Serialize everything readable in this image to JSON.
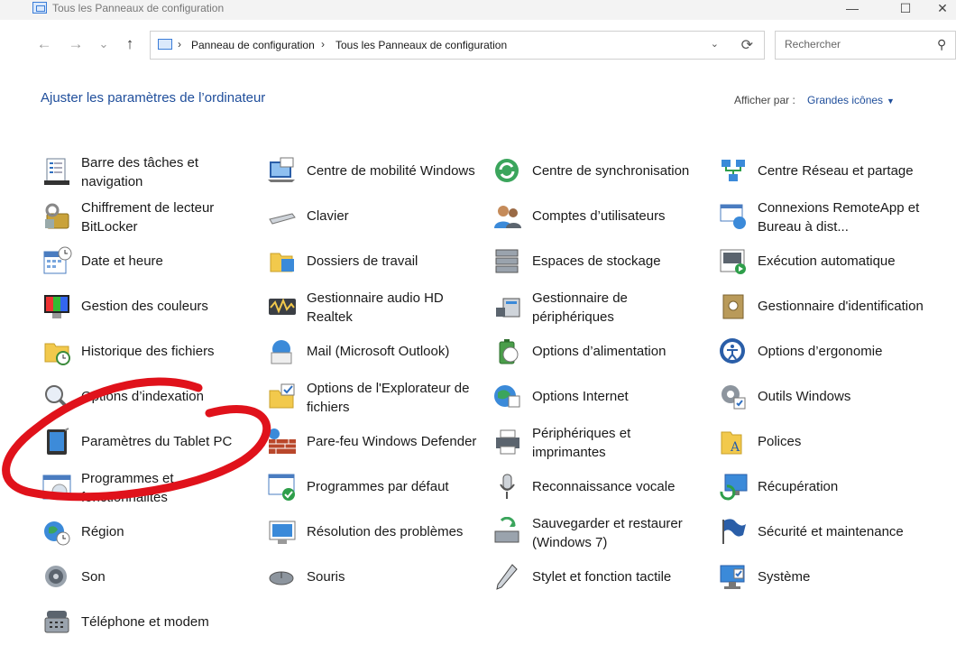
{
  "window": {
    "title": "Tous les Panneaux de configuration",
    "minimize": "—",
    "maximize": "☐",
    "close": "✕"
  },
  "nav": {
    "back": "←",
    "forward": "→",
    "recent": "⌄",
    "up": "↑"
  },
  "address": {
    "crumbs": [
      "Panneau de configuration",
      "Tous les Panneaux de configuration"
    ],
    "separator": "›",
    "dropdown": "⌄",
    "refresh": "⟳"
  },
  "search": {
    "placeholder": "Rechercher"
  },
  "header": {
    "title": "Ajuster les paramètres de l’ordinateur",
    "view_by_label": "Afficher par :",
    "view_by_value": "Grandes icônes",
    "view_arrow": "▼"
  },
  "columns": [
    [
      {
        "label": "Barre des tâches et navigation",
        "icon": "taskbar-icon"
      },
      {
        "label": "Chiffrement de lecteur BitLocker",
        "icon": "bitlocker-icon"
      },
      {
        "label": "Date et heure",
        "icon": "calendar-clock-icon"
      },
      {
        "label": "Gestion des couleurs",
        "icon": "color-management-icon"
      },
      {
        "label": "Historique des fichiers",
        "icon": "file-history-icon"
      },
      {
        "label": "Options d’indexation",
        "icon": "indexing-icon"
      },
      {
        "label": "Paramètres du Tablet PC",
        "icon": "tablet-icon"
      },
      {
        "label": "Programmes et fonctionnalités",
        "icon": "programs-icon"
      },
      {
        "label": "Région",
        "icon": "globe-clock-icon"
      },
      {
        "label": "Son",
        "icon": "speaker-icon"
      },
      {
        "label": "Téléphone et modem",
        "icon": "phone-icon"
      }
    ],
    [
      {
        "label": "Centre de mobilité Windows",
        "icon": "mobility-icon"
      },
      {
        "label": "Clavier",
        "icon": "keyboard-icon"
      },
      {
        "label": "Dossiers de travail",
        "icon": "work-folders-icon"
      },
      {
        "label": "Gestionnaire audio HD Realtek",
        "icon": "realtek-icon"
      },
      {
        "label": "Mail (Microsoft Outlook)",
        "icon": "mail-icon"
      },
      {
        "label": "Options de l'Explorateur de fichiers",
        "icon": "folder-options-icon"
      },
      {
        "label": "Pare-feu Windows Defender",
        "icon": "firewall-icon"
      },
      {
        "label": "Programmes par défaut",
        "icon": "default-programs-icon"
      },
      {
        "label": "Résolution des problèmes",
        "icon": "troubleshoot-icon"
      },
      {
        "label": "Souris",
        "icon": "mouse-icon"
      }
    ],
    [
      {
        "label": "Centre de synchronisation",
        "icon": "sync-icon"
      },
      {
        "label": "Comptes d’utilisateurs",
        "icon": "users-icon"
      },
      {
        "label": "Espaces de stockage",
        "icon": "storage-icon"
      },
      {
        "label": "Gestionnaire de périphériques",
        "icon": "device-manager-icon"
      },
      {
        "label": "Options d’alimentation",
        "icon": "power-icon"
      },
      {
        "label": "Options Internet",
        "icon": "internet-options-icon"
      },
      {
        "label": "Périphériques et imprimantes",
        "icon": "printer-icon"
      },
      {
        "label": "Reconnaissance vocale",
        "icon": "microphone-icon"
      },
      {
        "label": "Sauvegarder et restaurer (Windows 7)",
        "icon": "backup-icon"
      },
      {
        "label": "Stylet et fonction tactile",
        "icon": "pen-icon"
      }
    ],
    [
      {
        "label": "Centre Réseau et partage",
        "icon": "network-icon"
      },
      {
        "label": "Connexions RemoteApp et Bureau à dist...",
        "icon": "remoteapp-icon"
      },
      {
        "label": "Exécution automatique",
        "icon": "autoplay-icon"
      },
      {
        "label": "Gestionnaire d'identification",
        "icon": "credential-icon"
      },
      {
        "label": "Options d’ergonomie",
        "icon": "ease-of-access-icon"
      },
      {
        "label": "Outils Windows",
        "icon": "windows-tools-icon"
      },
      {
        "label": "Polices",
        "icon": "fonts-icon"
      },
      {
        "label": "Récupération",
        "icon": "recovery-icon"
      },
      {
        "label": "Sécurité et maintenance",
        "icon": "flag-icon"
      },
      {
        "label": "Système",
        "icon": "system-icon"
      }
    ]
  ],
  "annotation_color": "#e0121b"
}
